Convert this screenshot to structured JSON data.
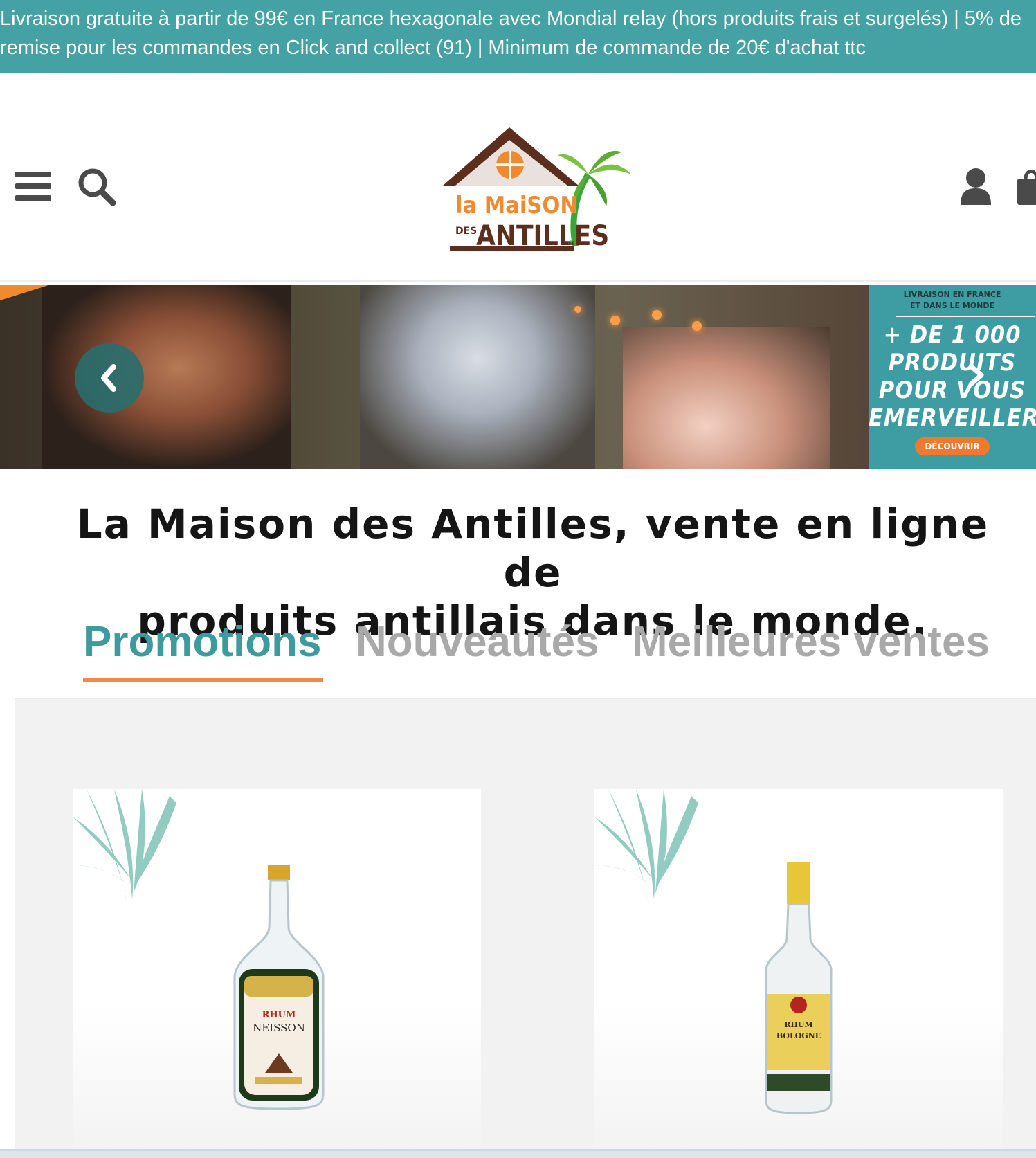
{
  "announcement": {
    "line1": "Livraison gratuite à partir de 99€ en France hexagonale avec Mondial relay (hors produits frais et surgelés) | 5% de",
    "line2": "remise pour les commandes en Click and collect (91) | Minimum de commande de 20€ d'achat ttc"
  },
  "header": {
    "logo": {
      "line1": "la MaiSON",
      "line2_small": "DES",
      "line2": "ANTILLES",
      "registered": "®"
    },
    "icons": [
      "menu-icon",
      "search-icon",
      "user-icon",
      "shopping-bag-icon"
    ]
  },
  "hero": {
    "promo_small_line1": "LIVRAISON EN FRANCE",
    "promo_small_line2": "ET DANS LE MONDE",
    "promo_big_line1": "+ DE 1 000",
    "promo_big_line2": "PRODUITS",
    "promo_big_line3": "POUR VOUS",
    "promo_big_line4": "EMERVEILLER",
    "cta": "DÉCOUVRIR"
  },
  "headline": {
    "line1": "La Maison des Antilles, vente en ligne de",
    "line2": "produits antillais dans le monde."
  },
  "tabs": [
    {
      "label": "Promotions",
      "active": true
    },
    {
      "label": "Nouveautés",
      "active": false
    },
    {
      "label": "Meilleures ventes",
      "active": false
    }
  ],
  "products": [
    {
      "bottle_label_line1": "RHUM",
      "bottle_label_line2": "NEISSON"
    },
    {
      "bottle_label_line1": "RHUM",
      "bottle_label_line2": "BOLOGNE"
    }
  ],
  "colors": {
    "teal": "#44a1a4",
    "tab_active": "#3d9a9e",
    "tab_inactive": "#a9a9a9",
    "underline": "#ef8a48",
    "cta_orange": "#f07a2a"
  }
}
